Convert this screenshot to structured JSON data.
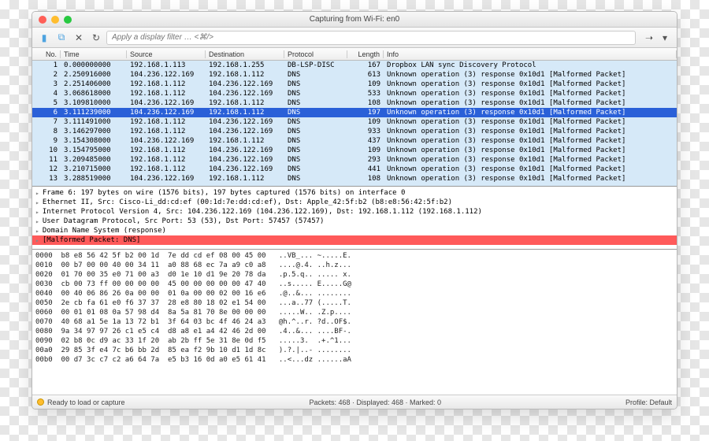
{
  "window": {
    "title": "Capturing from Wi-Fi: en0"
  },
  "filter": {
    "placeholder": "Apply a display filter … <⌘/>"
  },
  "columns": [
    "No.",
    "Time",
    "Source",
    "Destination",
    "Protocol",
    "Length",
    "Info"
  ],
  "packets": [
    {
      "no": "1",
      "time": "0.000000000",
      "src": "192.168.1.113",
      "dst": "192.168.1.255",
      "proto": "DB-LSP-DISC",
      "len": "167",
      "info": "Dropbox LAN sync Discovery Protocol"
    },
    {
      "no": "2",
      "time": "2.250916000",
      "src": "104.236.122.169",
      "dst": "192.168.1.112",
      "proto": "DNS",
      "len": "613",
      "info": "Unknown operation (3) response 0x10d1 [Malformed Packet]"
    },
    {
      "no": "3",
      "time": "2.251406000",
      "src": "192.168.1.112",
      "dst": "104.236.122.169",
      "proto": "DNS",
      "len": "109",
      "info": "Unknown operation (3) response 0x10d1 [Malformed Packet]"
    },
    {
      "no": "4",
      "time": "3.068618000",
      "src": "192.168.1.112",
      "dst": "104.236.122.169",
      "proto": "DNS",
      "len": "533",
      "info": "Unknown operation (3) response 0x10d1 [Malformed Packet]"
    },
    {
      "no": "5",
      "time": "3.109810000",
      "src": "104.236.122.169",
      "dst": "192.168.1.112",
      "proto": "DNS",
      "len": "108",
      "info": "Unknown operation (3) response 0x10d1 [Malformed Packet]"
    },
    {
      "no": "6",
      "time": "3.111239000",
      "src": "104.236.122.169",
      "dst": "192.168.1.112",
      "proto": "DNS",
      "len": "197",
      "info": "Unknown operation (3) response 0x10d1 [Malformed Packet]",
      "selected": true
    },
    {
      "no": "7",
      "time": "3.111491000",
      "src": "192.168.1.112",
      "dst": "104.236.122.169",
      "proto": "DNS",
      "len": "109",
      "info": "Unknown operation (3) response 0x10d1 [Malformed Packet]"
    },
    {
      "no": "8",
      "time": "3.146297000",
      "src": "192.168.1.112",
      "dst": "104.236.122.169",
      "proto": "DNS",
      "len": "933",
      "info": "Unknown operation (3) response 0x10d1 [Malformed Packet]"
    },
    {
      "no": "9",
      "time": "3.154308000",
      "src": "104.236.122.169",
      "dst": "192.168.1.112",
      "proto": "DNS",
      "len": "437",
      "info": "Unknown operation (3) response 0x10d1 [Malformed Packet]"
    },
    {
      "no": "10",
      "time": "3.154795000",
      "src": "192.168.1.112",
      "dst": "104.236.122.169",
      "proto": "DNS",
      "len": "109",
      "info": "Unknown operation (3) response 0x10d1 [Malformed Packet]"
    },
    {
      "no": "11",
      "time": "3.209485000",
      "src": "192.168.1.112",
      "dst": "104.236.122.169",
      "proto": "DNS",
      "len": "293",
      "info": "Unknown operation (3) response 0x10d1 [Malformed Packet]"
    },
    {
      "no": "12",
      "time": "3.210715000",
      "src": "192.168.1.112",
      "dst": "104.236.122.169",
      "proto": "DNS",
      "len": "441",
      "info": "Unknown operation (3) response 0x10d1 [Malformed Packet]"
    },
    {
      "no": "13",
      "time": "3.288519000",
      "src": "104.236.122.169",
      "dst": "192.168.1.112",
      "proto": "DNS",
      "len": "108",
      "info": "Unknown operation (3) response 0x10d1 [Malformed Packet]"
    }
  ],
  "details": [
    "Frame 6: 197 bytes on wire (1576 bits), 197 bytes captured (1576 bits) on interface 0",
    "Ethernet II, Src: Cisco-Li_dd:cd:ef (00:1d:7e:dd:cd:ef), Dst: Apple_42:5f:b2 (b8:e8:56:42:5f:b2)",
    "Internet Protocol Version 4, Src: 104.236.122.169 (104.236.122.169), Dst: 192.168.1.112 (192.168.1.112)",
    "User Datagram Protocol, Src Port: 53 (53), Dst Port: 57457 (57457)",
    "Domain Name System (response)"
  ],
  "details_error": "[Malformed Packet: DNS]",
  "hex": [
    "0000  b8 e8 56 42 5f b2 00 1d  7e dd cd ef 08 00 45 00   ..VB_... ~.....E.",
    "0010  00 b7 00 00 40 00 34 11  a0 88 68 ec 7a a9 c0 a8   ....@.4. ..h.z...",
    "0020  01 70 00 35 e0 71 00 a3  d0 1e 10 d1 9e 20 78 da   .p.5.q.. ..... x.",
    "0030  cb 00 73 ff 00 00 00 00  45 00 00 00 00 00 47 40   ..s..... E.....G@",
    "0040  00 40 06 86 26 0a 00 00  01 0a 00 00 02 00 16 e6   .@..&... ........",
    "0050  2e cb fa 61 e0 f6 37 37  28 e8 80 18 02 e1 54 00   ...a..77 (.....T.",
    "0060  00 01 01 08 0a 57 98 d4  8a 5a 81 70 8e 00 00 00   .....W.. .Z.p....",
    "0070  40 68 a1 5e 1a 13 72 b1  3f 64 03 bc 4f 46 24 a3   @h.^..r. ?d..OF$.",
    "0080  9a 34 97 97 26 c1 e5 c4  d8 a8 e1 a4 42 46 2d 00   .4..&... ....BF-.",
    "0090  02 b8 0c d9 ac 33 1f 20  ab 2b ff 5e 31 8e 0d f5   .....3.  .+.^1...",
    "00a0  29 85 3f e4 7c b6 bb 2d  85 ea f2 9b 10 d1 1d 8c   ).?.|..- ........",
    "00b0  00 d7 3c c7 c2 a6 64 7a  e5 b3 16 0d a0 e5 61 41   ..<...dz ......aA"
  ],
  "status": {
    "left": "Ready to load or capture",
    "mid": "Packets: 468 · Displayed: 468 · Marked: 0",
    "right": "Profile: Default"
  }
}
